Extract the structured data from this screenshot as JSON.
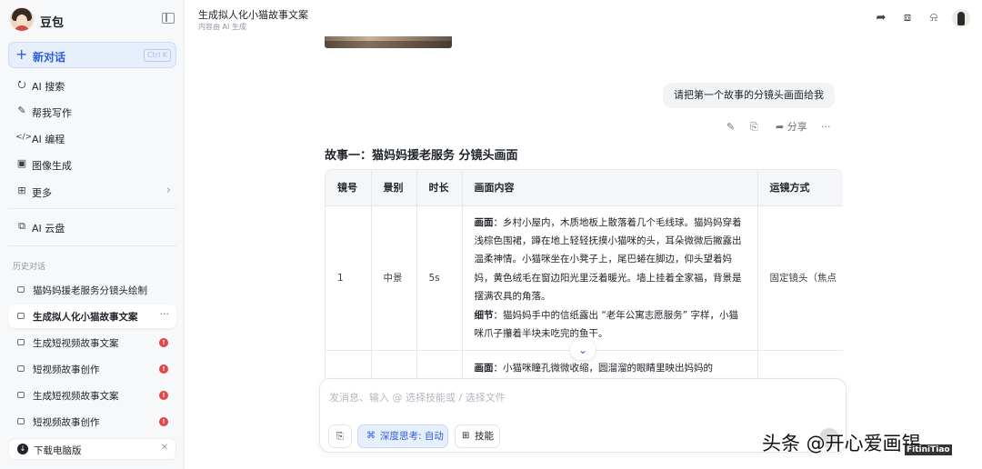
{
  "sidebar": {
    "app_name": "豆包",
    "new_chat": {
      "label": "新对话",
      "shortcut": "Ctrl K"
    },
    "nav": [
      {
        "icon": "ai-search-icon",
        "label": "AI 搜索"
      },
      {
        "icon": "pen-icon",
        "label": "帮我写作"
      },
      {
        "icon": "code-icon",
        "label": "AI 编程"
      },
      {
        "icon": "image-icon",
        "label": "图像生成"
      },
      {
        "icon": "grid-icon",
        "label": "更多"
      }
    ],
    "cloud": {
      "icon": "cloud-drive-icon",
      "label": "AI 云盘"
    },
    "history_label": "历史对话",
    "history": [
      {
        "label": "猫妈妈援老服务分镜头绘制",
        "active": false,
        "badge": ""
      },
      {
        "label": "生成拟人化小猫故事文案",
        "active": true,
        "badge": ""
      },
      {
        "label": "生成短视频故事文案",
        "active": false,
        "badge": "!"
      },
      {
        "label": "短视频故事创作",
        "active": false,
        "badge": "!"
      },
      {
        "label": "生成短视频故事文案",
        "active": false,
        "badge": "!"
      },
      {
        "label": "短视频故事创作",
        "active": false,
        "badge": "!"
      }
    ],
    "download": "下载电脑版"
  },
  "header": {
    "title": "生成拟人化小猫故事文案",
    "subtitle": "内容由 AI 生成"
  },
  "chat": {
    "user_message": "请把第一个故事的分镜头画面给我",
    "actions": {
      "share": "分享"
    },
    "story_title": "故事一：猫妈妈援老服务 分镜头画面",
    "table": {
      "headers": [
        "镜号",
        "景别",
        "时长",
        "画面内容",
        "运镜方式"
      ],
      "rows": [
        {
          "no": "1",
          "shot": "中景",
          "duration": "5s",
          "scene_label": "画面",
          "scene": "：乡村小屋内，木质地板上散落着几个毛线球。猫妈妈穿着浅棕色围裙，蹲在地上轻轻抚摸小猫咪的头，耳朵微微后撇露出温柔神情。小猫咪坐在小凳子上，尾巴蜷在脚边，仰头望着妈妈，黄色绒毛在窗边阳光里泛着暖光。墙上挂着全家福，背景是摆满农具的角落。",
          "detail_label": "细节",
          "detail": "：猫妈妈手中的信纸露出 “老年公寓志愿服务” 字样，小猫咪爪子攥着半块未吃完的鱼干。",
          "camera": "固定镜头（焦点"
        },
        {
          "no": "",
          "shot": "",
          "duration": "",
          "scene_label": "画面",
          "scene": "：小猫咪瞳孔微微收缩，圆溜溜的眼睛里映出妈妈的",
          "camera": ""
        }
      ]
    }
  },
  "composer": {
    "placeholder": "发消息、输入 @ 选择技能或 / 选择文件",
    "deep_think": "深度思考: 自动",
    "skills": "技能"
  },
  "watermark": {
    "text": "头条 @开心爱画锡",
    "brand": "FitiniTiao"
  },
  "colors": {
    "accent": "#2b5fd9",
    "badge": "#e54545",
    "sidebar_bg": "#f7f8fa"
  }
}
